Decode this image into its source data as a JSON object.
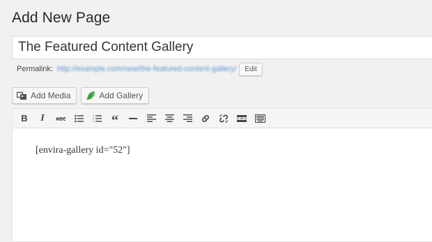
{
  "header": {
    "title": "Add New Page"
  },
  "post": {
    "title_value": "The Featured Content Gallery",
    "permalink_label": "Permalink:",
    "permalink_url": "http://example.com/new/the-featured-content-gallery/",
    "edit_label": "Edit"
  },
  "media_buttons": {
    "add_media": "Add Media",
    "add_gallery": "Add Gallery"
  },
  "toolbar": {
    "buttons": [
      {
        "name": "bold",
        "icon": "bold-icon"
      },
      {
        "name": "italic",
        "icon": "italic-icon"
      },
      {
        "name": "strikethrough",
        "icon": "strikethrough-icon"
      },
      {
        "name": "bullet-list",
        "icon": "bullet-list-icon"
      },
      {
        "name": "numbered-list",
        "icon": "numbered-list-icon"
      },
      {
        "name": "blockquote",
        "icon": "blockquote-icon"
      },
      {
        "name": "horizontal-line",
        "icon": "horizontal-line-icon"
      },
      {
        "name": "align-left",
        "icon": "align-left-icon"
      },
      {
        "name": "align-center",
        "icon": "align-center-icon"
      },
      {
        "name": "align-right",
        "icon": "align-right-icon"
      },
      {
        "name": "insert-link",
        "icon": "link-icon"
      },
      {
        "name": "remove-link",
        "icon": "unlink-icon"
      },
      {
        "name": "read-more",
        "icon": "read-more-icon"
      },
      {
        "name": "toolbar-toggle",
        "icon": "keyboard-icon"
      }
    ]
  },
  "editor": {
    "content": "[envira-gallery id=\"52\"]"
  },
  "colors": {
    "background": "#f1f1f1",
    "link": "#5b95cf",
    "gallery_leaf": "#4caf50"
  }
}
